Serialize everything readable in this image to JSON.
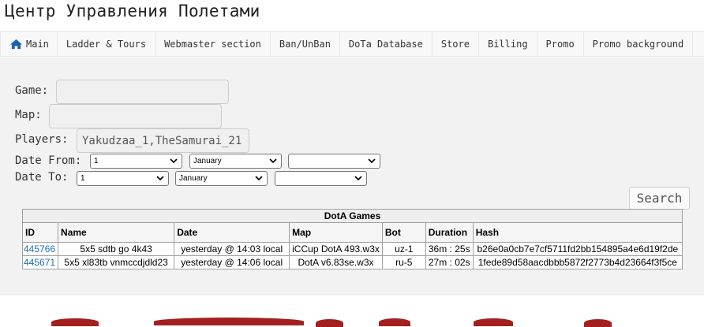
{
  "app": {
    "title": "Центр Управления Полетами"
  },
  "nav": {
    "items": [
      {
        "label": "Main",
        "icon": "home-icon"
      },
      {
        "label": "Ladder & Tours"
      },
      {
        "label": "Webmaster section"
      },
      {
        "label": "Ban/UnBan"
      },
      {
        "label": "DoTa Database"
      },
      {
        "label": "Store"
      },
      {
        "label": "Billing"
      },
      {
        "label": "Promo"
      },
      {
        "label": "Promo background"
      }
    ]
  },
  "filters": {
    "game_label": "Game:",
    "game_value": "",
    "map_label": "Map:",
    "map_value": "",
    "players_label": "Players:",
    "players_value": "Yakudzaa_1,TheSamurai_21",
    "date_from_label": "Date From:",
    "date_from": {
      "day": "1",
      "month": "January",
      "year": ""
    },
    "date_to_label": "Date To:",
    "date_to": {
      "day": "1",
      "month": "January",
      "year": ""
    },
    "search_label": "Search"
  },
  "table": {
    "caption": "DotA Games",
    "columns": [
      "ID",
      "Name",
      "Date",
      "Map",
      "Bot",
      "Duration",
      "Hash"
    ],
    "rows": [
      [
        "445766",
        "5x5 sdtb go 4k43",
        "yesterday @ 14:03 local",
        "iCCup DotA 493.w3x",
        "uz-1",
        "36m : 25s",
        "b26e0a0cb7e7cf5711fd2bb154895a4e6d19f2de"
      ],
      [
        "445671",
        "5x5 xl83tb vnmccdjdld23",
        "yesterday @ 14:06 local",
        "DotA v6.83se.w3x",
        "ru-5",
        "27m : 02s",
        "1fede89d58aacdbbb5872f2773b4d23664f3f5ce"
      ]
    ]
  },
  "colors": {
    "link": "#1f6fb2",
    "background_panel": "#f2f2f2",
    "decor_red": "#a3201e"
  }
}
